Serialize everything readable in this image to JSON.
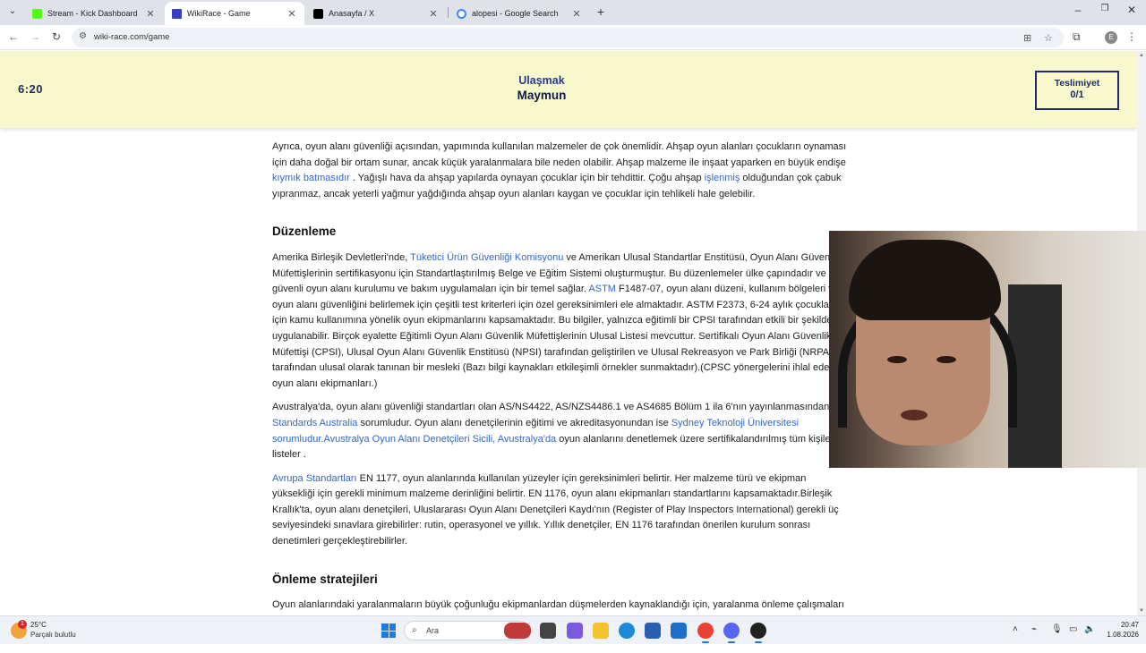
{
  "browser": {
    "tabs": [
      {
        "title": "Stream - Kick Dashboard",
        "icon": "kick-icon",
        "color": "#53fc18"
      },
      {
        "title": "WikiRace - Game",
        "icon": "wikirace-icon",
        "color": "#3b3fbf",
        "active": true
      },
      {
        "title": "Anasayfa / X",
        "icon": "x-icon",
        "color": "#000000"
      },
      {
        "title": "alopesi - Google Search",
        "icon": "google-icon",
        "color": "#4285f4"
      }
    ],
    "url": "wiki-race.com/game",
    "profile_initial": "E"
  },
  "game": {
    "timer": "6:20",
    "target_label": "Ulaşmak",
    "target_word": "Maymun",
    "surrender_label": "Teslimiyet",
    "surrender_count": "0/1"
  },
  "article": {
    "p1": {
      "t1": "Ayrıca, oyun alanı güvenliği açısından, yapımında kullanılan malzemeler de çok önemlidir. Ahşap oyun alanları çocukların oynaması için daha doğal bir ortam sunar, ancak küçük yaralanmalara bile neden olabilir. Ahşap malzeme ile inşaat yaparken en büyük endişe ",
      "link1": "kıymık batmasıdır",
      "t2": " . Yağışlı hava da ahşap yapılarda oynayan çocuklar için bir tehdittir. Çoğu ahşap ",
      "link2": "işlenmiş",
      "t3": " olduğundan çok çabuk yıpranmaz, ancak yeterli yağmur yağdığında ahşap oyun alanları kaygan ve çocuklar için tehlikeli hale gelebilir."
    },
    "h_regulation": "Düzenleme",
    "p2": {
      "t1": "Amerika Birleşik Devletleri'nde, ",
      "link1": "Tüketici Ürün Güvenliği Komisyonu",
      "t2": " ve Amerikan Ulusal Standartlar Enstitüsü, Oyun Alanı Güvenlik Müfettişlerinin sertifikasyonu için Standartlaştırılmış Belge ve Eğitim Sistemi oluşturmuştur. Bu düzenlemeler ülke çapındadır ve güvenli oyun alanı kurulumu ve bakım uygulamaları için bir temel sağlar. ",
      "link2": "ASTM",
      "t3": " F1487-07, oyun alanı düzeni, kullanım bölgeleri ve oyun alanı güvenliğini belirlemek için çeşitli test kriterleri için özel gereksinimleri ele almaktadır. ASTM F2373, 6-24 aylık çocuklar için kamu kullanımına yönelik oyun ekipmanlarını kapsamaktadır. Bu bilgiler, yalnızca eğitimli bir CPSI tarafından etkili bir şekilde uygulanabilir. Birçok eyalette Eğitimli Oyun Alanı Güvenlik Müfettişlerinin Ulusal Listesi mevcuttur. Sertifikalı Oyun Alanı Güvenlik Müfettişi (CPSI), Ulusal Oyun Alanı Güvenlik Enstitüsü (NPSI) tarafından geliştirilen ve Ulusal Rekreasyon ve Park Birliği (NRPA) tarafından ulusal olarak tanınan bir mesleki (Bazı bilgi kaynakları etkileşimli örnekler sunmaktadır).(CPSC yönergelerini ihlal eden oyun alanı ekipmanları.)"
    },
    "p3": {
      "t1": "Avustralya'da, oyun alanı güvenliği standartları olan AS/NS4422, AS/NZS4486.1 ve AS4685 Bölüm 1 ila 6'nın yayınlanmasından ",
      "link1": "Standards Australia",
      "t2": " sorumludur. Oyun alanı denetçilerinin eğitimi ve akreditasyonundan ise ",
      "link2": "Sydney Teknoloji Üniversitesi sorumludur.Avustralya Oyun Alanı Denetçileri Sicili, Avustralya'da",
      "t3": " oyun alanlarını denetlemek üzere sertifikalandırılmış tüm kişileri listeler ."
    },
    "p4": {
      "link1": "Avrupa Standartları",
      "t1": " EN 1177, oyun alanlarında kullanılan yüzeyler için gereksinimleri belirtir. Her malzeme türü ve ekipman yüksekliği için gerekli minimum malzeme derinliğini belirtir. EN 1176, oyun alanı ekipmanları standartlarını kapsamaktadır.Birleşik Krallık'ta, oyun alanı denetçileri, Uluslararası Oyun Alanı Denetçileri Kaydı'nın (Register of Play Inspectors International) gerekli üç seviyesindeki sınavlara girebilirler: rutin, operasyonel ve yıllık. Yıllık denetçiler, EN 1176 tarafından önerilen kurulum sonrası denetimleri gerçekleştirebilirler."
    },
    "h_prevention": "Önleme stratejileri",
    "p5": "Oyun alanlarındaki yaralanmaların büyük çoğunluğu ekipmanlardan düşmelerden kaynaklandığı için, yaralanma önleme çalışmaları öncelikle çocuğun düşme olasılığını azaltmaya ve düşmesi durumunda ciddi yaralanma olasılığını düşürmeye yöneliktir. Bu, şu yollarla yapılır:"
  },
  "taskbar": {
    "weather_temp": "25°C",
    "weather_desc": "Parçalı bulutlu",
    "weather_badge": "1",
    "search_placeholder": "Ara",
    "time": "20:47",
    "date": "1.08.2026"
  },
  "colors": {
    "game_header_bg": "#f7f9cc",
    "game_text": "#1e2a5a",
    "link": "#3366cc"
  }
}
